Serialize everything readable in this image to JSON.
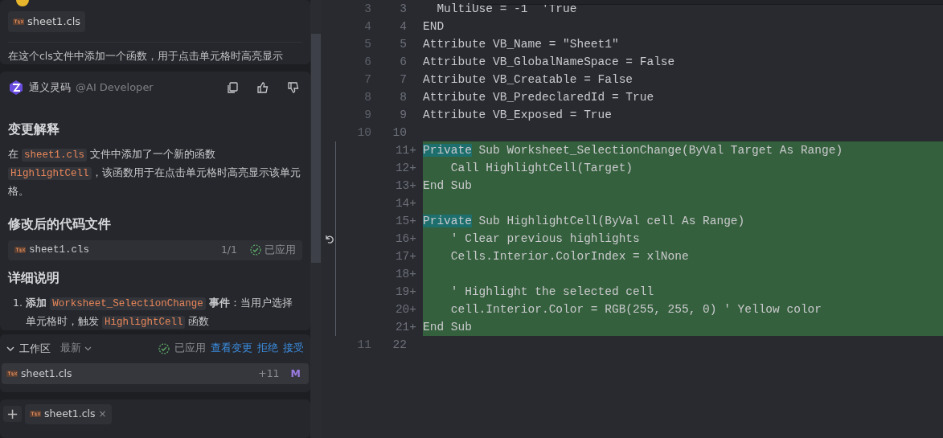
{
  "chat": {
    "user_message": {
      "attachment": "sheet1.cls",
      "text": "在这个cls文件中添加一个函数，用于点击单元格时高亮显示"
    },
    "assistant": {
      "name": "通义灵码",
      "handle": "@AI Developer",
      "heading_1": "变更解释",
      "paragraph": [
        {
          "kind": "text",
          "text": "在 "
        },
        {
          "kind": "code",
          "text": "sheet1.cls"
        },
        {
          "kind": "text",
          "text": " 文件中添加了一个新的函数 "
        },
        {
          "kind": "code",
          "text": "HighlightCell"
        },
        {
          "kind": "text",
          "text": "，该函数用于在点击单元格时高亮显示该单元格。"
        }
      ],
      "heading_2": "修改后的代码文件",
      "code_file": {
        "name": "sheet1.cls",
        "count": "1/1",
        "status": "已应用"
      },
      "heading_3": "详细说明",
      "list": [
        {
          "number": "1.",
          "segments": [
            {
              "kind": "bold",
              "text": "添加 "
            },
            {
              "kind": "code",
              "text": "Worksheet_SelectionChange"
            },
            {
              "kind": "bold",
              "text": " 事件"
            },
            {
              "kind": "text",
              "text": "：当用户选择单元格时，触发 "
            },
            {
              "kind": "code",
              "text": "HighlightCell"
            },
            {
              "kind": "text",
              "text": " 函数"
            }
          ]
        }
      ]
    }
  },
  "workspace": {
    "title": "工作区",
    "filter": "最新",
    "status": "已应用",
    "actions": [
      "查看变更",
      "拒绝",
      "接受"
    ],
    "files": [
      {
        "name": "sheet1.cls",
        "additions": "+11",
        "state": "M"
      }
    ]
  },
  "input": {
    "add": "+",
    "chips": [
      {
        "name": "sheet1.cls",
        "close": "×"
      }
    ]
  },
  "editor": {
    "lines": [
      {
        "old": "3",
        "new": "3",
        "added": false,
        "code": [
          {
            "text": "  MultiUse = -1  'True",
            "highlighted": false
          }
        ]
      },
      {
        "old": "4",
        "new": "4",
        "added": false,
        "code": [
          {
            "text": "END",
            "highlighted": false
          }
        ]
      },
      {
        "old": "5",
        "new": "5",
        "added": false,
        "code": [
          {
            "text": "Attribute VB_Name = \"Sheet1\"",
            "highlighted": false
          }
        ]
      },
      {
        "old": "6",
        "new": "6",
        "added": false,
        "code": [
          {
            "text": "Attribute VB_GlobalNameSpace = False",
            "highlighted": false
          }
        ]
      },
      {
        "old": "7",
        "new": "7",
        "added": false,
        "code": [
          {
            "text": "Attribute VB_Creatable = False",
            "highlighted": false
          }
        ]
      },
      {
        "old": "8",
        "new": "8",
        "added": false,
        "code": [
          {
            "text": "Attribute VB_PredeclaredId = True",
            "highlighted": false
          }
        ]
      },
      {
        "old": "9",
        "new": "9",
        "added": false,
        "code": [
          {
            "text": "Attribute VB_Exposed = True",
            "highlighted": false
          }
        ]
      },
      {
        "old": "10",
        "new": "10",
        "added": false
      },
      {
        "new": "11+",
        "added": true,
        "code": [
          {
            "text": "Private",
            "highlighted": true
          },
          {
            "text": " Sub Worksheet_SelectionChange(ByVal Target As Range)",
            "highlighted": false
          }
        ]
      },
      {
        "new": "12+",
        "added": true,
        "code": [
          {
            "text": "    Call HighlightCell(Target)",
            "highlighted": false
          }
        ]
      },
      {
        "new": "13+",
        "added": true,
        "code": [
          {
            "text": "End Sub",
            "highlighted": false
          }
        ]
      },
      {
        "new": "14+",
        "added": true
      },
      {
        "new": "15+",
        "added": true,
        "code": [
          {
            "text": "Private",
            "highlighted": true
          },
          {
            "text": " Sub HighlightCell(ByVal cell As Range)",
            "highlighted": false
          }
        ]
      },
      {
        "new": "16+",
        "added": true,
        "revert": true,
        "code": [
          {
            "text": "    ' Clear previous highlights",
            "highlighted": false
          }
        ]
      },
      {
        "new": "17+",
        "added": true,
        "code": [
          {
            "text": "    Cells.Interior.ColorIndex = xlNone",
            "highlighted": false
          }
        ]
      },
      {
        "new": "18+",
        "added": true
      },
      {
        "new": "19+",
        "added": true,
        "code": [
          {
            "text": "    ' Highlight the selected cell",
            "highlighted": false
          }
        ]
      },
      {
        "new": "20+",
        "added": true,
        "code": [
          {
            "text": "    cell.Interior.Color = RGB(255, 255, 0) ' Yellow color",
            "highlighted": false
          }
        ]
      },
      {
        "new": "21+",
        "added": true,
        "code": [
          {
            "text": "End Sub",
            "highlighted": false
          }
        ]
      },
      {
        "old": "11",
        "new": "22",
        "added": false
      }
    ]
  }
}
